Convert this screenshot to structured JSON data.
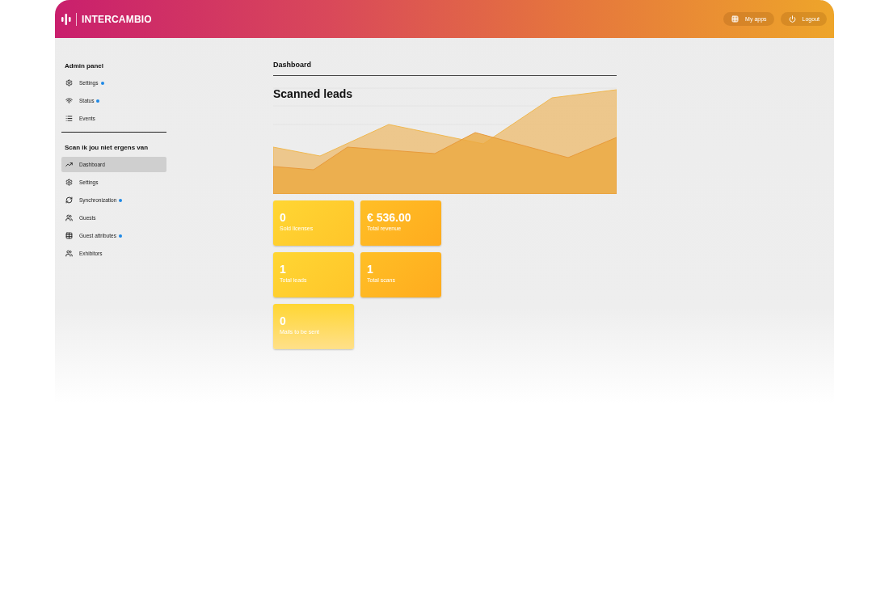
{
  "header": {
    "brand": "INTERCAMBIO",
    "buttons": [
      {
        "label": "My apps"
      },
      {
        "label": "Logout"
      }
    ]
  },
  "sidebar": {
    "sections": [
      {
        "title": "Admin panel",
        "items": [
          {
            "label": "Settings",
            "notification": true,
            "selected": false
          },
          {
            "label": "Status",
            "notification": true,
            "selected": false
          },
          {
            "label": "Events",
            "notification": false,
            "selected": false
          }
        ]
      },
      {
        "title": "Scan ik jou niet ergens van",
        "items": [
          {
            "label": "Dashboard",
            "notification": false,
            "selected": true
          },
          {
            "label": "Settings",
            "notification": false,
            "selected": false
          },
          {
            "label": "Synchronization",
            "notification": true,
            "selected": false
          },
          {
            "label": "Guests",
            "notification": false,
            "selected": false
          },
          {
            "label": "Guest attributes",
            "notification": true,
            "selected": false
          },
          {
            "label": "Exhibitors",
            "notification": false,
            "selected": false
          }
        ]
      }
    ]
  },
  "main": {
    "title": "Dashboard",
    "chart": {
      "title": "Scanned leads"
    },
    "stats": [
      {
        "value": "0",
        "label": "Sold licenses"
      },
      {
        "value": "€ 536.00",
        "label": "Total revenue"
      },
      {
        "value": "1",
        "label": "Total leads"
      },
      {
        "value": "1",
        "label": "Total scans"
      },
      {
        "value": "0",
        "label": "Mails to be sent"
      }
    ]
  }
}
